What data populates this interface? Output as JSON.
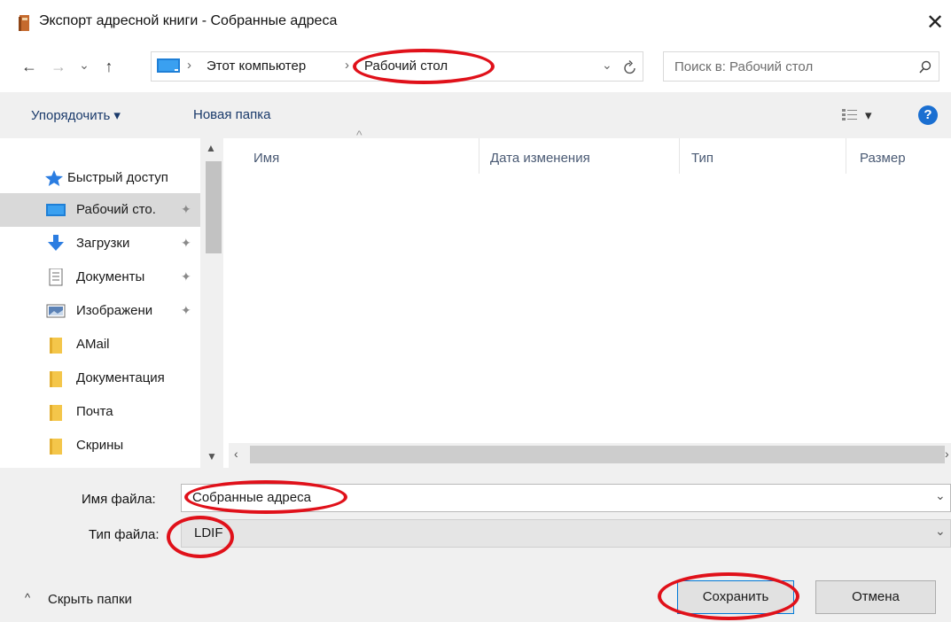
{
  "window": {
    "title": "Экспорт адресной книги - Собранные адреса",
    "close_glyph": "✕"
  },
  "nav": {
    "back": "←",
    "forward": "→",
    "dropdown": "⌄",
    "up": "↑",
    "breadcrumb": [
      "Этот компьютер",
      "Рабочий стол"
    ],
    "separator": "›",
    "search_placeholder": "Поиск в: Рабочий стол"
  },
  "toolbar": {
    "organize": "Упорядочить ▾",
    "new_folder": "Новая папка",
    "view_arrow": "▾",
    "help": "?"
  },
  "sidebar": {
    "items": [
      {
        "label": "Быстрый доступ",
        "icon": "star-icon",
        "pinned": false
      },
      {
        "label": "Рабочий сто.",
        "icon": "desktop-icon",
        "pinned": true
      },
      {
        "label": "Загрузки",
        "icon": "download-icon",
        "pinned": true
      },
      {
        "label": "Документы",
        "icon": "document-icon",
        "pinned": true
      },
      {
        "label": "Изображени",
        "icon": "image-icon",
        "pinned": true
      },
      {
        "label": "AMail",
        "icon": "folder-icon",
        "pinned": false
      },
      {
        "label": "Документация",
        "icon": "folder-icon",
        "pinned": false
      },
      {
        "label": "Почта",
        "icon": "folder-icon",
        "pinned": false
      },
      {
        "label": "Скрины",
        "icon": "folder-icon",
        "pinned": false
      }
    ]
  },
  "filelist": {
    "columns": [
      "Имя",
      "Дата изменения",
      "Тип",
      "Размер"
    ],
    "sort_glyph": "^"
  },
  "form": {
    "filename_label": "Имя файла:",
    "filename_value": "Собранные адреса",
    "filetype_label": "Тип файла:",
    "filetype_value": "LDIF",
    "hide_folders": "Скрыть папки",
    "save": "Сохранить",
    "cancel": "Отмена"
  },
  "colors": {
    "annotation_red": "#e0111a",
    "selection_gray": "#d9d9d9",
    "help_blue": "#1a6fd1",
    "folder_yellow": "#f4c64a"
  }
}
